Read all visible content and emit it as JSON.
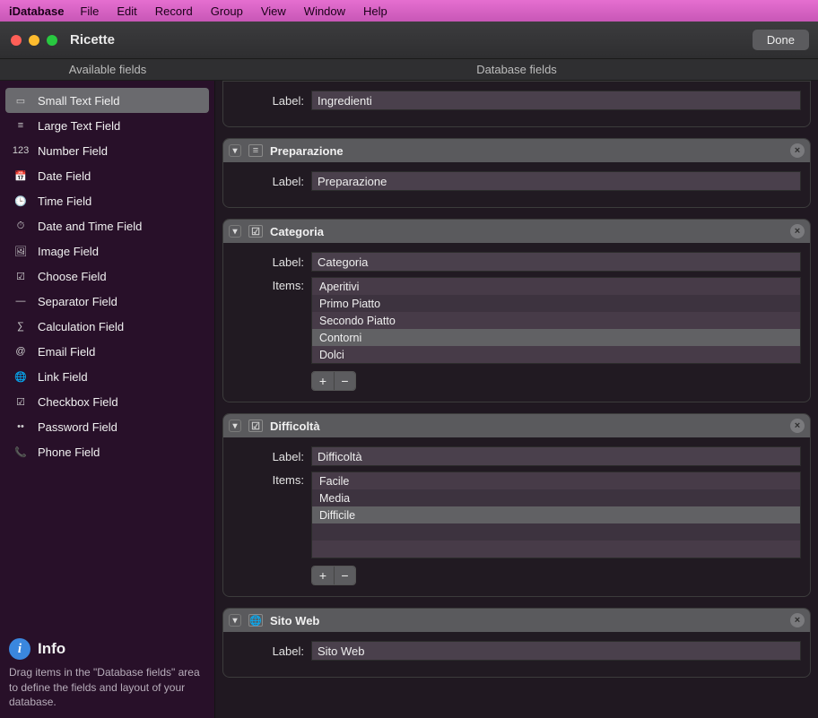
{
  "menubar": {
    "app": "iDatabase",
    "items": [
      "File",
      "Edit",
      "Record",
      "Group",
      "View",
      "Window",
      "Help"
    ]
  },
  "window": {
    "title": "Ricette",
    "done": "Done"
  },
  "tabs": {
    "left": "Available fields",
    "right": "Database fields"
  },
  "sidebar": {
    "fields": [
      {
        "label": "Small Text Field",
        "icon": "small-text-field-icon",
        "selected": true
      },
      {
        "label": "Large Text Field",
        "icon": "large-text-field-icon",
        "selected": false
      },
      {
        "label": "Number Field",
        "icon": "number-field-icon",
        "selected": false
      },
      {
        "label": "Date Field",
        "icon": "date-field-icon",
        "selected": false
      },
      {
        "label": "Time Field",
        "icon": "time-field-icon",
        "selected": false
      },
      {
        "label": "Date and Time Field",
        "icon": "datetime-field-icon",
        "selected": false
      },
      {
        "label": "Image Field",
        "icon": "image-field-icon",
        "selected": false
      },
      {
        "label": "Choose Field",
        "icon": "choose-field-icon",
        "selected": false
      },
      {
        "label": "Separator Field",
        "icon": "separator-field-icon",
        "selected": false
      },
      {
        "label": "Calculation Field",
        "icon": "calculation-field-icon",
        "selected": false
      },
      {
        "label": "Email Field",
        "icon": "email-field-icon",
        "selected": false
      },
      {
        "label": "Link Field",
        "icon": "link-field-icon",
        "selected": false
      },
      {
        "label": "Checkbox Field",
        "icon": "checkbox-field-icon",
        "selected": false
      },
      {
        "label": "Password Field",
        "icon": "password-field-icon",
        "selected": false
      },
      {
        "label": "Phone Field",
        "icon": "phone-field-icon",
        "selected": false
      }
    ],
    "info_title": "Info",
    "info_text": "Drag items in the \"Database fields\" area to define the fields and layout of your database."
  },
  "labels": {
    "label": "Label:",
    "items": "Items:"
  },
  "sections": [
    {
      "id": "ingredienti",
      "partial": true,
      "label_value": "Ingredienti"
    },
    {
      "id": "preparazione",
      "title": "Preparazione",
      "type_icon": "large-text-field-icon",
      "label_value": "Preparazione"
    },
    {
      "id": "categoria",
      "title": "Categoria",
      "type_icon": "choose-field-icon",
      "label_value": "Categoria",
      "items": [
        "Aperitivi",
        "Primo Piatto",
        "Secondo Piatto",
        "Contorni",
        "Dolci"
      ],
      "selected_index": 3,
      "empty_rows": 0
    },
    {
      "id": "difficolta",
      "title": "Difficoltà",
      "type_icon": "choose-field-icon",
      "label_value": "Difficoltà",
      "items": [
        "Facile",
        "Media",
        "Difficile"
      ],
      "selected_index": 2,
      "empty_rows": 2
    },
    {
      "id": "sitoweb",
      "title": "Sito Web",
      "type_icon": "link-field-icon",
      "label_value": "Sito Web"
    }
  ]
}
